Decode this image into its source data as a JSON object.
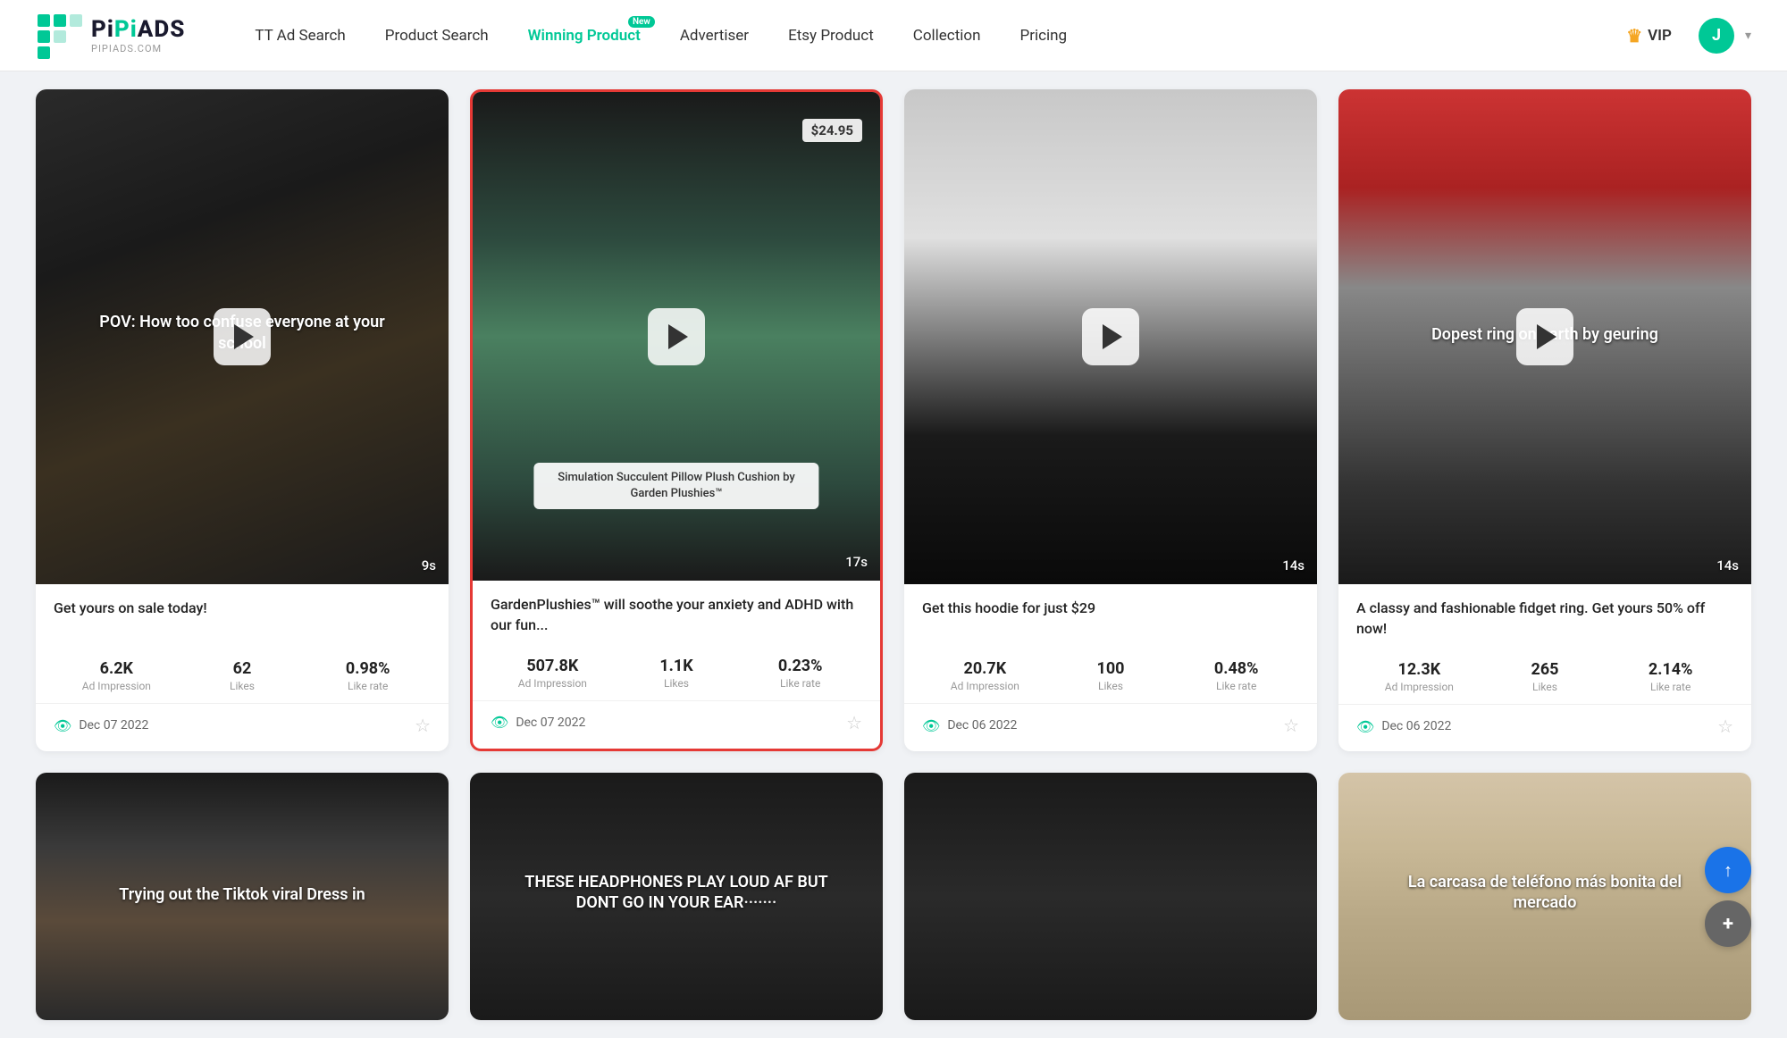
{
  "header": {
    "logo_main": "PiPiADS",
    "logo_sub": "PIPIADS.COM",
    "nav_items": [
      {
        "id": "tt-ad-search",
        "label": "TT Ad Search",
        "active": false,
        "badge": null
      },
      {
        "id": "product-search",
        "label": "Product Search",
        "active": false,
        "badge": null
      },
      {
        "id": "winning-product",
        "label": "Winning Product",
        "active": true,
        "badge": "New"
      },
      {
        "id": "advertiser",
        "label": "Advertiser",
        "active": false,
        "badge": null
      },
      {
        "id": "etsy-product",
        "label": "Etsy Product",
        "active": false,
        "badge": null
      },
      {
        "id": "collection",
        "label": "Collection",
        "active": false,
        "badge": null
      },
      {
        "id": "pricing",
        "label": "Pricing",
        "active": false,
        "badge": null
      }
    ],
    "vip_label": "VIP",
    "avatar_letter": "J"
  },
  "cards": [
    {
      "id": "card-1",
      "highlighted": false,
      "thumb_class": "thumb-1",
      "thumb_text": "POV: How too confuse everyone at your school",
      "price_badge": null,
      "product_label": null,
      "duration": "9s",
      "title": "Get yours on sale today!",
      "ad_impression": "6.2K",
      "likes": "62",
      "like_rate": "0.98%",
      "date": "Dec 07 2022"
    },
    {
      "id": "card-2",
      "highlighted": true,
      "thumb_class": "thumb-2",
      "thumb_text": null,
      "price_badge": "$24.95",
      "product_label": "Simulation Succulent Pillow Plush Cushion by Garden Plushies™",
      "duration": "17s",
      "title": "GardenPlushies™ will soothe your anxiety and ADHD with our fun...",
      "ad_impression": "507.8K",
      "likes": "1.1K",
      "like_rate": "0.23%",
      "date": "Dec 07 2022"
    },
    {
      "id": "card-3",
      "highlighted": false,
      "thumb_class": "thumb-3",
      "thumb_text": null,
      "price_badge": null,
      "product_label": null,
      "duration": "14s",
      "title": "Get this hoodie for just $29",
      "ad_impression": "20.7K",
      "likes": "100",
      "like_rate": "0.48%",
      "date": "Dec 06 2022"
    },
    {
      "id": "card-4",
      "highlighted": false,
      "thumb_class": "thumb-4",
      "thumb_text": "Dopest ring on earth by geuring",
      "price_badge": null,
      "product_label": null,
      "duration": "14s",
      "title": "A classy and fashionable fidget ring. Get yours 50% off now!",
      "ad_impression": "12.3K",
      "likes": "265",
      "like_rate": "2.14%",
      "date": "Dec 06 2022"
    },
    {
      "id": "card-5",
      "highlighted": false,
      "thumb_class": "thumb-5",
      "thumb_text": "Trying out the Tiktok viral Dress in",
      "price_badge": null,
      "product_label": null,
      "duration": null,
      "title": "",
      "ad_impression": "",
      "likes": "",
      "like_rate": "",
      "date": ""
    },
    {
      "id": "card-6",
      "highlighted": false,
      "thumb_class": "thumb-6",
      "thumb_text": "THESE HEADPHONES PLAY LOUD AF BUT DONT GO IN YOUR EAR·······",
      "price_badge": null,
      "product_label": null,
      "duration": null,
      "title": "",
      "ad_impression": "",
      "likes": "",
      "like_rate": "",
      "date": ""
    },
    {
      "id": "card-7",
      "highlighted": false,
      "thumb_class": "thumb-7",
      "thumb_text": null,
      "price_badge": null,
      "product_label": null,
      "duration": null,
      "title": "",
      "ad_impression": "",
      "likes": "",
      "like_rate": "",
      "date": ""
    },
    {
      "id": "card-8",
      "highlighted": false,
      "thumb_class": "thumb-8",
      "thumb_text": "La carcasa de teléfono más bonita del mercado",
      "price_badge": null,
      "product_label": null,
      "duration": null,
      "title": "",
      "ad_impression": "",
      "likes": "",
      "like_rate": "",
      "date": ""
    }
  ],
  "labels": {
    "ad_impression": "Ad Impression",
    "likes": "Likes",
    "like_rate": "Like rate"
  },
  "scroll_top_title": "Back to top",
  "help_label": "+"
}
